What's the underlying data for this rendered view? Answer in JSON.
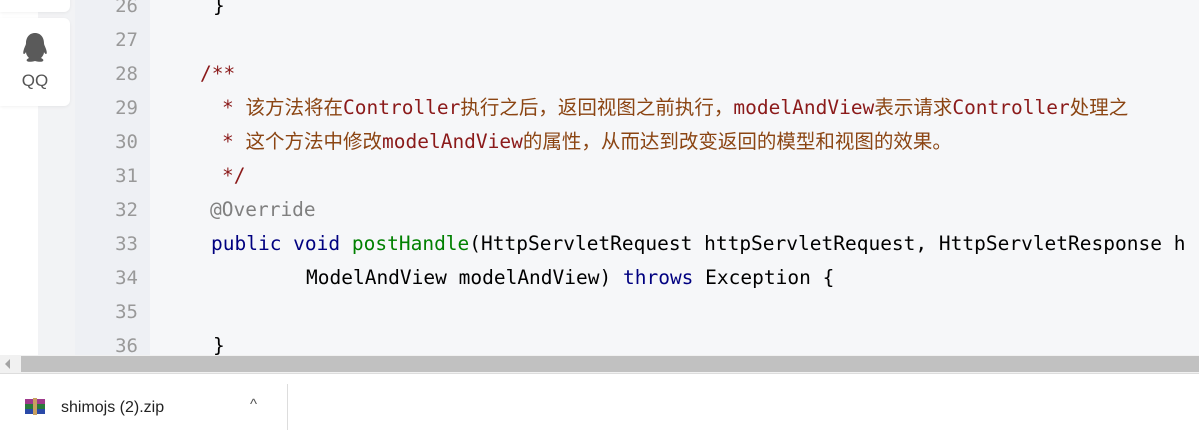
{
  "sidebar": {
    "qq_label": "QQ"
  },
  "editor": {
    "lines": [
      {
        "n": "26",
        "indent": 63,
        "parts": [
          {
            "t": "}",
            "c": ""
          }
        ]
      },
      {
        "n": "27",
        "indent": 0,
        "parts": []
      },
      {
        "n": "28",
        "indent": 50,
        "parts": [
          {
            "t": "/**",
            "c": "cm"
          }
        ]
      },
      {
        "n": "29",
        "indent": 72,
        "parts": [
          {
            "t": "* ",
            "c": "cm"
          },
          {
            "t": "该方法将在",
            "c": "zh"
          },
          {
            "t": "Controller",
            "c": "cm"
          },
          {
            "t": "执行之后，返回视图之前执行，",
            "c": "zh"
          },
          {
            "t": "modelAndView",
            "c": "cm"
          },
          {
            "t": "表示请求",
            "c": "zh"
          },
          {
            "t": "Controller",
            "c": "cm"
          },
          {
            "t": "处理之",
            "c": "zh"
          }
        ]
      },
      {
        "n": "30",
        "indent": 72,
        "parts": [
          {
            "t": "* ",
            "c": "cm"
          },
          {
            "t": "这个方法中修改",
            "c": "zh"
          },
          {
            "t": "modelAndView",
            "c": "cm"
          },
          {
            "t": "的属性，从而达到改变返回的模型和视图的效果。",
            "c": "zh"
          }
        ]
      },
      {
        "n": "31",
        "indent": 72,
        "parts": [
          {
            "t": "*/",
            "c": "cm"
          }
        ]
      },
      {
        "n": "32",
        "indent": 60,
        "parts": [
          {
            "t": "@Override",
            "c": "an"
          }
        ]
      },
      {
        "n": "33",
        "indent": 61,
        "parts": [
          {
            "t": "public void ",
            "c": "kw"
          },
          {
            "t": "postHandle",
            "c": "fn"
          },
          {
            "t": "(HttpServletRequest httpServletRequest, HttpServletResponse h",
            "c": ""
          }
        ]
      },
      {
        "n": "34",
        "indent": 156,
        "parts": [
          {
            "t": "ModelAndView modelAndView) ",
            "c": ""
          },
          {
            "t": "throws ",
            "c": "kw"
          },
          {
            "t": "Exception {",
            "c": ""
          }
        ]
      },
      {
        "n": "35",
        "indent": 0,
        "parts": []
      },
      {
        "n": "36",
        "indent": 63,
        "parts": [
          {
            "t": "}",
            "c": ""
          }
        ]
      }
    ]
  },
  "downloads": {
    "file_name": "shimojs (2).zip",
    "chevron": "^"
  },
  "colors": {
    "comment": "#8b1a1a",
    "keyword": "#000080",
    "method": "#008000",
    "annotation": "#808080"
  }
}
